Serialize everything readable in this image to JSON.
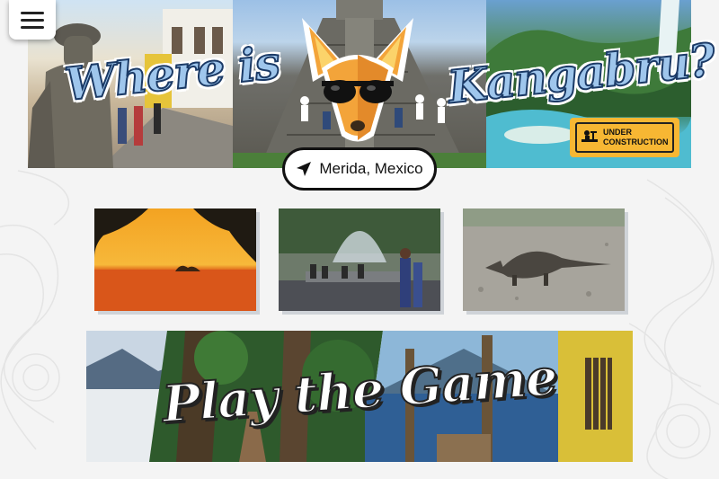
{
  "header": {
    "menu_icon": "hamburger-menu-icon",
    "title_left": "Where is",
    "title_right": "Kangabru?",
    "badge_line1": "Under",
    "badge_line2": "Construction",
    "badge_icon": "construction-worker-icon"
  },
  "location": {
    "label": "Merida, Mexico",
    "icon": "location-arrow-icon"
  },
  "gallery": [
    {
      "subject": "sunset-over-sea"
    },
    {
      "subject": "plaza-fountain"
    },
    {
      "subject": "armadillo"
    }
  ],
  "play": {
    "label": "Play the Game"
  },
  "colors": {
    "title_fill": "#9fc6ec",
    "title_outline": "#1b3a66",
    "badge_bg": "#f7b733",
    "mascot_orange": "#f3a43a"
  }
}
